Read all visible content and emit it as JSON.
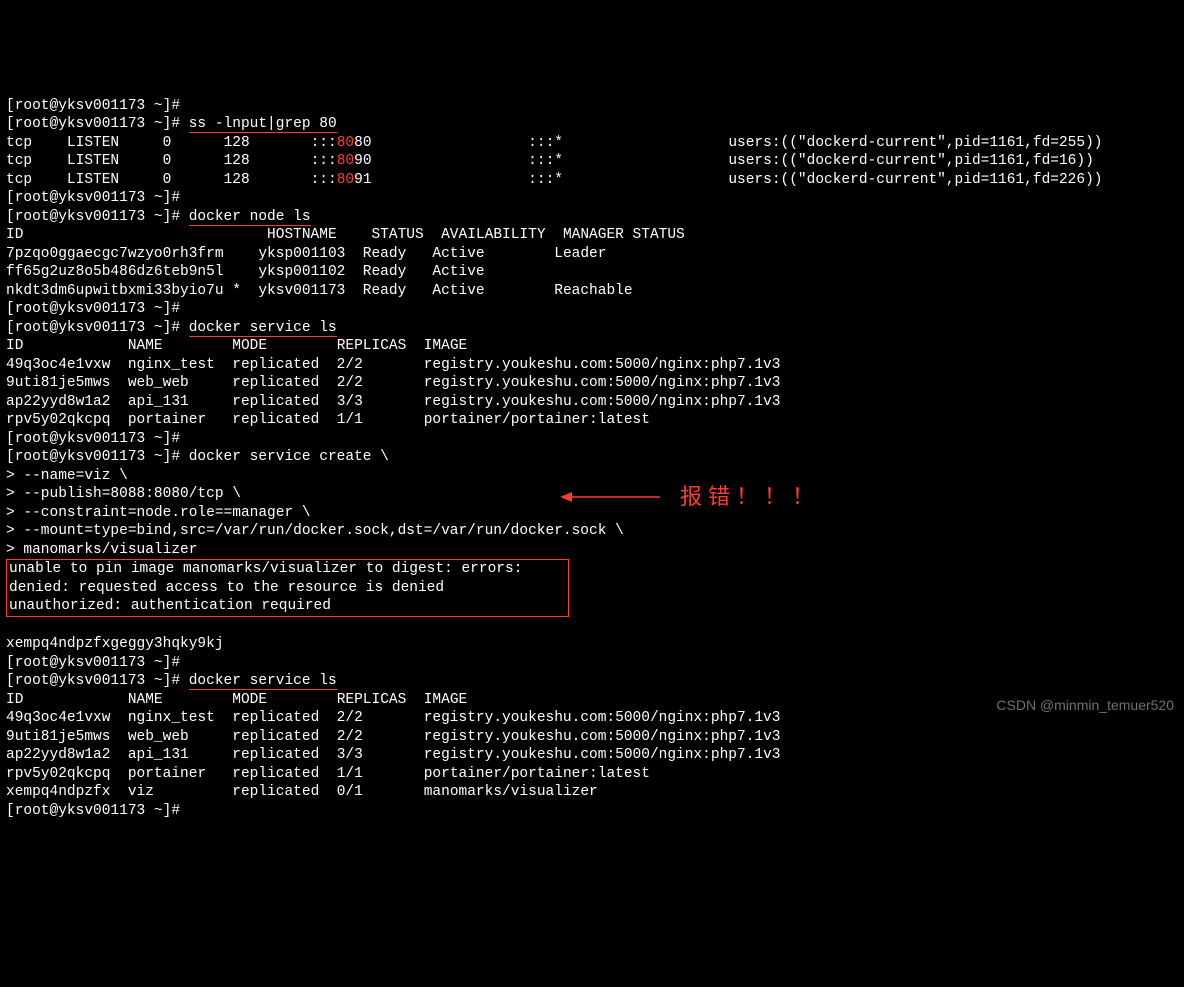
{
  "prompt": "[root@yksv001173 ~]#",
  "cmd1": "ss -lnput|grep 80",
  "ss": [
    {
      "proto": "tcp",
      "state": "LISTEN",
      "recvq": "0",
      "sendq": "128",
      "local_pre": ":::",
      "local_port": "80",
      "local_post": "80",
      "peer": ":::*",
      "users": "users:((\"dockerd-current\",pid=1161,fd=255))"
    },
    {
      "proto": "tcp",
      "state": "LISTEN",
      "recvq": "0",
      "sendq": "128",
      "local_pre": ":::",
      "local_port": "80",
      "local_post": "90",
      "peer": ":::*",
      "users": "users:((\"dockerd-current\",pid=1161,fd=16))"
    },
    {
      "proto": "tcp",
      "state": "LISTEN",
      "recvq": "0",
      "sendq": "128",
      "local_pre": ":::",
      "local_port": "80",
      "local_post": "91",
      "peer": ":::*",
      "users": "users:((\"dockerd-current\",pid=1161,fd=226))"
    }
  ],
  "cmd2": "docker node ls",
  "nodes_header": {
    "id": "ID",
    "hostname": "HOSTNAME",
    "status": "STATUS",
    "availability": "AVAILABILITY",
    "manager": "MANAGER STATUS"
  },
  "nodes": [
    {
      "id": "7pzqo0ggaecgc7wzyo0rh3frm",
      "mark": " ",
      "hostname": "yksp001103",
      "status": "Ready",
      "availability": "Active",
      "manager": "Leader"
    },
    {
      "id": "ff65g2uz8o5b486dz6teb9n5l",
      "mark": " ",
      "hostname": "yksp001102",
      "status": "Ready",
      "availability": "Active",
      "manager": ""
    },
    {
      "id": "nkdt3dm6upwitbxmi33byio7u",
      "mark": "*",
      "hostname": "yksv001173",
      "status": "Ready",
      "availability": "Active",
      "manager": "Reachable"
    }
  ],
  "cmd3": "docker service ls",
  "svc_header": {
    "id": "ID",
    "name": "NAME",
    "mode": "MODE",
    "replicas": "REPLICAS",
    "image": "IMAGE"
  },
  "svcs1": [
    {
      "id": "49q3oc4e1vxw",
      "name": "nginx_test",
      "mode": "replicated",
      "replicas": "2/2",
      "image": "registry.youkeshu.com:5000/nginx:php7.1v3"
    },
    {
      "id": "9uti81je5mws",
      "name": "web_web",
      "mode": "replicated",
      "replicas": "2/2",
      "image": "registry.youkeshu.com:5000/nginx:php7.1v3"
    },
    {
      "id": "ap22yyd8w1a2",
      "name": "api_131",
      "mode": "replicated",
      "replicas": "3/3",
      "image": "registry.youkeshu.com:5000/nginx:php7.1v3"
    },
    {
      "id": "rpv5y02qkcpq",
      "name": "portainer",
      "mode": "replicated",
      "replicas": "1/1",
      "image": "portainer/portainer:latest"
    }
  ],
  "create": {
    "line1": "docker service create \\",
    "line2": "> --name=viz \\",
    "line3": "> --publish=8088:8080/tcp \\",
    "line4": "> --constraint=node.role==manager \\",
    "line5": "> --mount=type=bind,src=/var/run/docker.sock,dst=/var/run/docker.sock \\",
    "line6": "> manomarks/visualizer"
  },
  "error": {
    "line1": "unable to pin image manomarks/visualizer to digest: errors:",
    "line2": "denied: requested access to the resource is denied",
    "line3": "unauthorized: authentication required"
  },
  "created_id": "xempq4ndpzfxgeggy3hqky9kj",
  "cmd4": "docker service ls",
  "svcs2": [
    {
      "id": "49q3oc4e1vxw",
      "name": "nginx_test",
      "mode": "replicated",
      "replicas": "2/2",
      "image": "registry.youkeshu.com:5000/nginx:php7.1v3"
    },
    {
      "id": "9uti81je5mws",
      "name": "web_web",
      "mode": "replicated",
      "replicas": "2/2",
      "image": "registry.youkeshu.com:5000/nginx:php7.1v3"
    },
    {
      "id": "ap22yyd8w1a2",
      "name": "api_131",
      "mode": "replicated",
      "replicas": "3/3",
      "image": "registry.youkeshu.com:5000/nginx:php7.1v3"
    },
    {
      "id": "rpv5y02qkcpq",
      "name": "portainer",
      "mode": "replicated",
      "replicas": "1/1",
      "image": "portainer/portainer:latest"
    },
    {
      "id": "xempq4ndpzfx",
      "name": "viz",
      "mode": "replicated",
      "replicas": "0/1",
      "image": "manomarks/visualizer"
    }
  ],
  "annotation": "报错！！！",
  "watermark": "CSDN @minmin_temuer520"
}
